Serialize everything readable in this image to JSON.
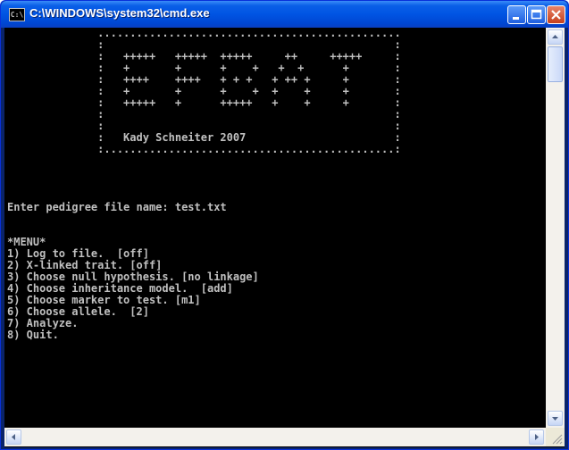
{
  "window": {
    "title": "C:\\WINDOWS\\system32\\cmd.exe",
    "icon_label": "C:\\"
  },
  "console": {
    "lines": [
      "              ...............................................",
      "              :                                             :",
      "              :   +++++   +++++  +++++     ++     +++++     :",
      "              :   +       +      +    +   +  +      +       :",
      "              :   ++++    ++++   + + +   + ++ +     +       :",
      "              :   +       +      +    +  +    +     +       :",
      "              :   +++++   +      +++++   +    +     +       :",
      "              :                                             :",
      "              :                                             :",
      "              :   Kady Schneiter 2007                       :",
      "              :.............................................:",
      "",
      "",
      "",
      "",
      "Enter pedigree file name: test.txt",
      "",
      "",
      "*MENU*",
      "1) Log to file.  [off]",
      "2) X-linked trait. [off]",
      "3) Choose null hypothesis. [no linkage]",
      "4) Choose inheritance model.  [add]",
      "5) Choose marker to test. [m1]",
      "6) Choose allele.  [2]",
      "7) Analyze.",
      "8) Quit."
    ]
  },
  "colors": {
    "console_bg": "#000000",
    "console_text": "#c0c0c0",
    "titlebar": "#0054e3"
  }
}
